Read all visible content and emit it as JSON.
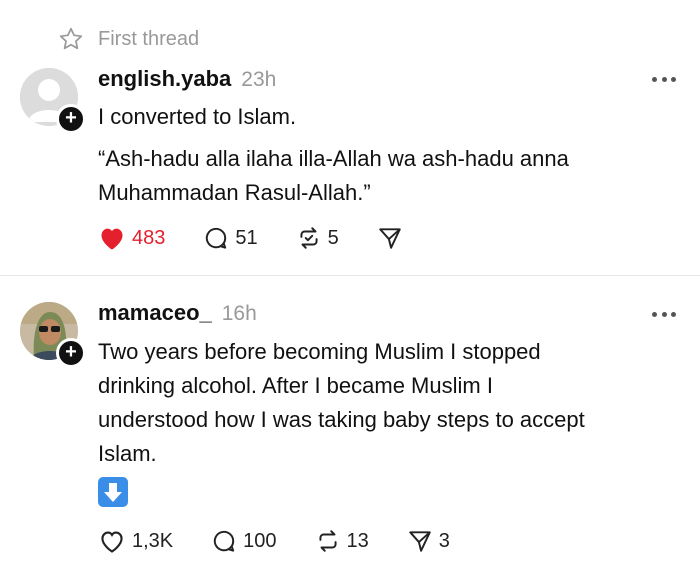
{
  "thread": {
    "title": "First thread"
  },
  "posts": [
    {
      "username": "english.yaba",
      "time": "23h",
      "lines": [
        "I converted to Islam.",
        "“Ash-hadu alla ilaha illa-Allah wa ash-hadu anna",
        "Muhammadan Rasul-Allah.”"
      ],
      "likes": "483",
      "liked": true,
      "replies": "51",
      "reposts": "5",
      "shares": "",
      "colors": {
        "like": "#e5202e"
      }
    },
    {
      "username": "mamaceo_",
      "time": "16h",
      "lines": [
        "Two years before becoming Muslim I stopped",
        "drinking alcohol. After I became Muslim I",
        "understood how I was taking baby steps to accept",
        "Islam."
      ],
      "emoji": "down-arrow-emoji",
      "likes": "1,3K",
      "liked": false,
      "replies": "100",
      "reposts": "13",
      "shares": "3"
    }
  ],
  "icons": {
    "star": "star-icon",
    "plus": "+",
    "more": "more-dots-icon",
    "heart": "heart-icon",
    "reply": "reply-icon",
    "repost": "repost-icon",
    "share": "send-icon"
  }
}
